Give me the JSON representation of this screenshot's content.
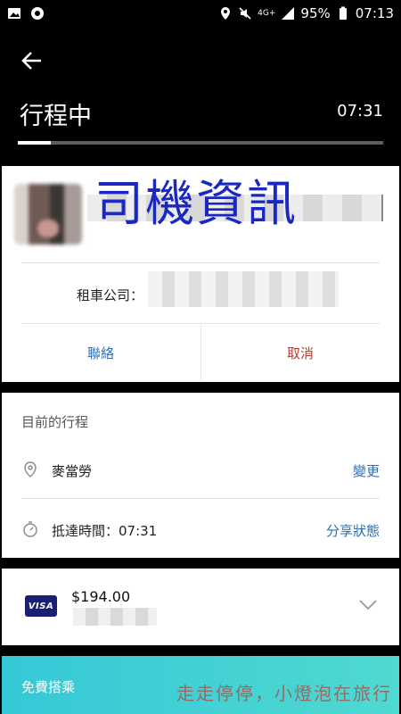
{
  "status_bar": {
    "network": "4G+",
    "battery": "95%",
    "clock": "07:13"
  },
  "header": {
    "title": "行程中",
    "time": "07:31",
    "progress_fraction": 0.09
  },
  "driver_card": {
    "overlay_label": "司機資訊",
    "rental_company_label": "租車公司：",
    "contact_label": "聯絡",
    "cancel_label": "取消"
  },
  "route_card": {
    "heading": "目前的行程",
    "destination": "麥當勞",
    "change_label": "變更",
    "arrival_label": "抵達時間：07:31",
    "share_label": "分享狀態"
  },
  "payment": {
    "brand": "VISA",
    "amount": "$194.00"
  },
  "promo": {
    "label": "免費搭乘",
    "watermark": "走走停停，小燈泡在旅行"
  },
  "colors": {
    "cancel": "#c0392b",
    "contact": "#2b6fb6",
    "link": "#2b6fb6",
    "promo": "#35c8d6",
    "visa": "#1a1f71"
  }
}
